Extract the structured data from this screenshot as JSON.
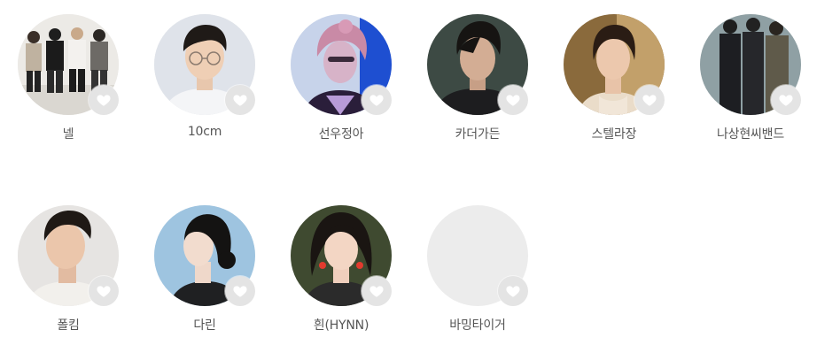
{
  "artists": [
    {
      "name": "넬",
      "photo": "band-of-four-photo"
    },
    {
      "name": "10cm",
      "photo": "man-with-glasses-photo"
    },
    {
      "name": "선우정아",
      "photo": "woman-pink-hair-photo"
    },
    {
      "name": "카더가든",
      "photo": "man-dark-hair-photo"
    },
    {
      "name": "스텔라장",
      "photo": "woman-lace-top-photo"
    },
    {
      "name": "나상현씨밴드",
      "photo": "band-of-three-photo"
    },
    {
      "name": "폴킴",
      "photo": "man-white-shirt-photo"
    },
    {
      "name": "다린",
      "photo": "woman-profile-photo"
    },
    {
      "name": "흰(HYNN)",
      "photo": "woman-red-earrings-photo"
    },
    {
      "name": "바밍타이거",
      "photo": "placeholder"
    }
  ],
  "icons": {
    "like": "heart-icon"
  },
  "colors": {
    "like_background": "#e4e4e4",
    "heart": "#ffffff",
    "name_text": "#555555",
    "placeholder": "#ececec"
  }
}
